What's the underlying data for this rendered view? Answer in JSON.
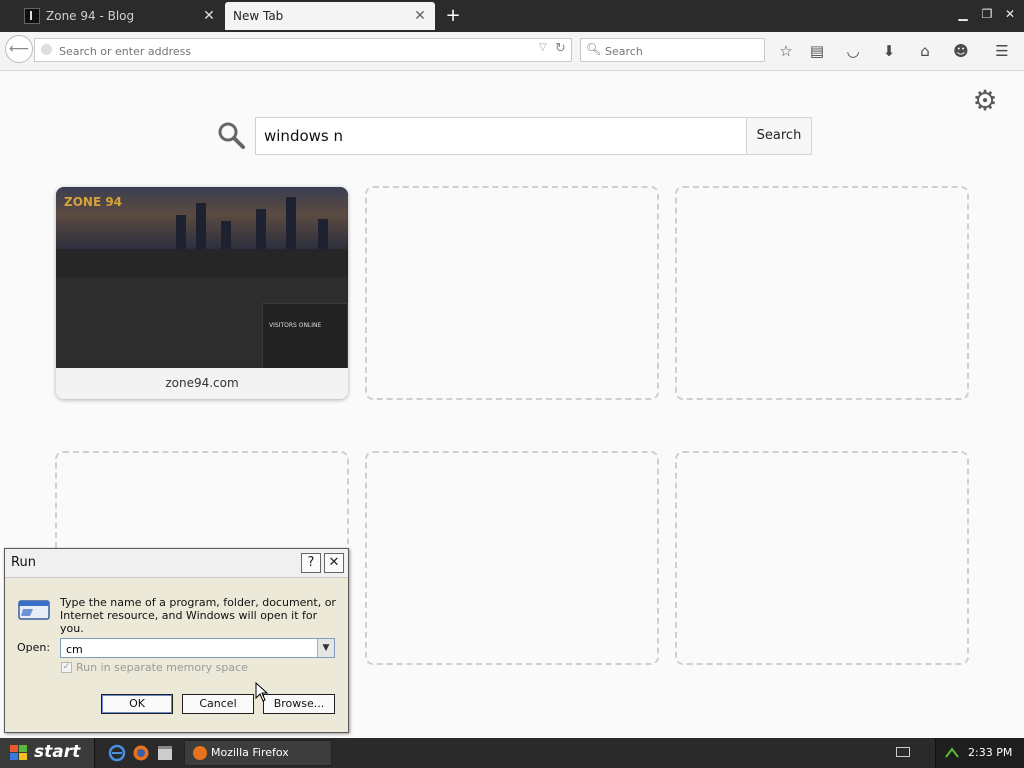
{
  "browser": {
    "tabs": [
      {
        "label": "Zone 94 - Blog",
        "active": false
      },
      {
        "label": "New Tab",
        "active": true
      }
    ],
    "address_placeholder": "Search or enter address",
    "search_placeholder": "Search"
  },
  "newtab": {
    "search_value": "windows n",
    "search_button": "Search",
    "tiles": [
      {
        "site": "zone94.com",
        "thumb_logo": "ZONE 94",
        "thumb_panel": "VISITORS ONLINE"
      }
    ]
  },
  "run_dialog": {
    "title": "Run",
    "help_button": "?",
    "close_button": "✕",
    "description": "Type the name of a program, folder, document, or Internet resource, and Windows will open it for you.",
    "open_label": "Open:",
    "open_value": "cm",
    "checkbox_label": "Run in separate memory space",
    "checkbox_checked": true,
    "checkbox_enabled": false,
    "ok": "OK",
    "cancel": "Cancel",
    "browse": "Browse..."
  },
  "taskbar": {
    "start": "start",
    "task_firefox": "Mozilla Firefox",
    "clock": "2:33 PM"
  }
}
